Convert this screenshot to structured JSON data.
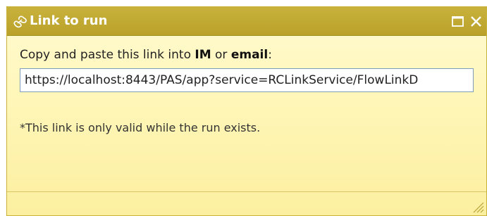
{
  "dialog": {
    "title": "Link to run",
    "title_icon": "link-icon",
    "maximize_icon": "maximize-icon",
    "close_icon": "close-icon"
  },
  "content": {
    "instruction_prefix": "Copy and paste this link into ",
    "instruction_im": "IM",
    "instruction_or": " or ",
    "instruction_email": "email",
    "instruction_suffix": ":",
    "link_value": "https://localhost:8443/PAS/app?service=RCLinkService/FlowLinkD",
    "note": "*This link is only valid while the run exists."
  },
  "colors": {
    "titlebar": "#bfa832",
    "body": "#fff6b8",
    "input_border": "#7f9db9"
  }
}
